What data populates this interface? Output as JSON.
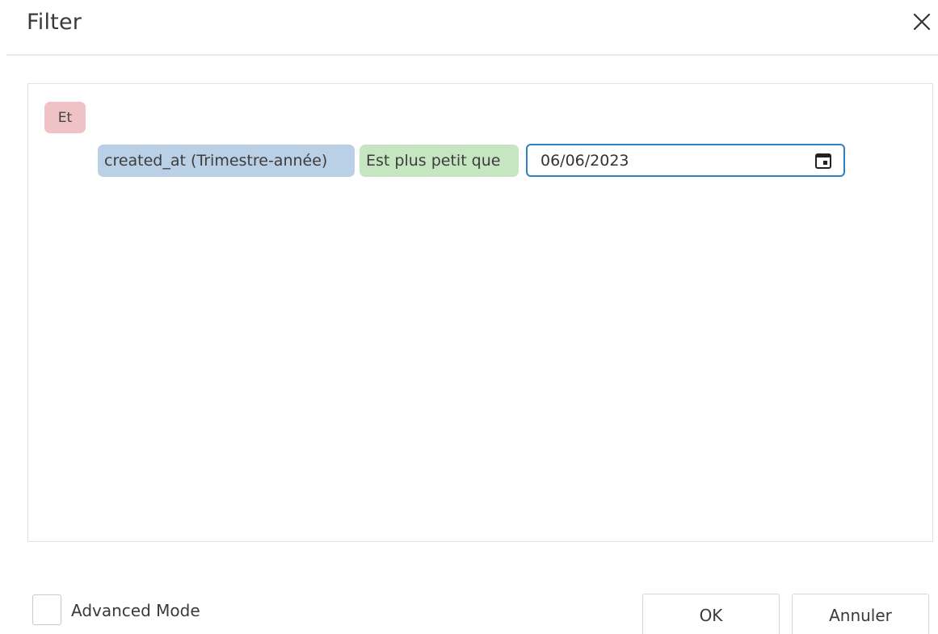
{
  "dialog": {
    "title": "Filter",
    "close_icon": "close-icon"
  },
  "filter": {
    "group_operator": "Et",
    "conditions": [
      {
        "field": "created_at (Trimestre-année)",
        "operator": "Est plus petit que",
        "value": "06/06/2023",
        "value_icon": "calendar-icon"
      }
    ]
  },
  "footer": {
    "advanced_mode_label": "Advanced Mode",
    "advanced_mode_checked": false,
    "ok_label": "OK",
    "cancel_label": "Annuler"
  },
  "colors": {
    "group_badge": "#efc3c5",
    "field_chip": "#b9d0e6",
    "operator_chip": "#c6e5c1",
    "input_focus_border": "#2f7fc3"
  }
}
